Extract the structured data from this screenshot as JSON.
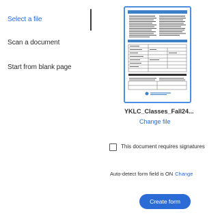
{
  "nav": {
    "items": [
      {
        "label": "Select a file",
        "active": true
      },
      {
        "label": "Scan a document",
        "active": false
      },
      {
        "label": "Start from blank page",
        "active": false
      }
    ]
  },
  "file": {
    "name": "YKLC_Classes_Fall24...",
    "change_label": "Change file"
  },
  "signatures": {
    "label": "This document requires signatures",
    "checked": false
  },
  "auto_detect": {
    "text": "Auto-detect form field is ON",
    "change_label": "Change"
  },
  "create_button": {
    "label": "Create form"
  },
  "colors": {
    "accent": "#2b6cd4",
    "thumbnail_border": "#4a8fe0",
    "button_bg": "#2b6bd6"
  }
}
